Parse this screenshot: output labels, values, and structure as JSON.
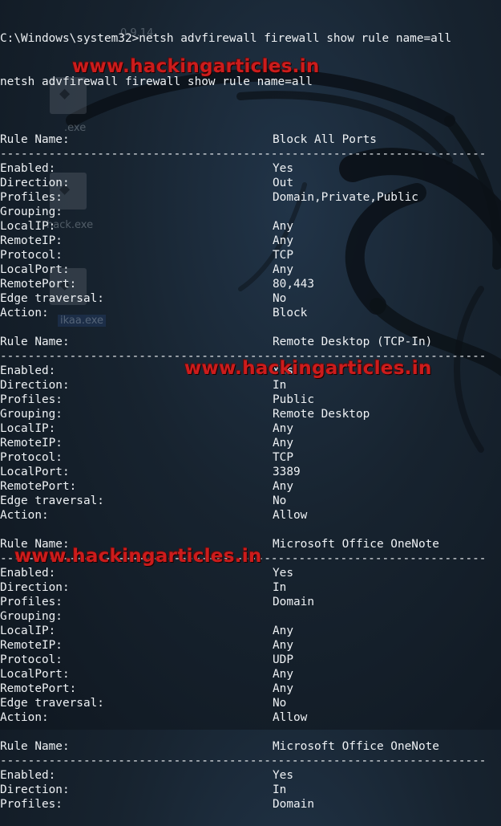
{
  "desktop": {
    "version_text": "0.9.14",
    "icons": [
      {
        "label": ".exe"
      },
      {
        "label": "hack.exe"
      },
      {
        "label": "ikaa.exe"
      }
    ]
  },
  "terminal": {
    "prompt_line": "C:\\Windows\\system32>netsh advfirewall firewall show rule name=all",
    "echo_line": "netsh advfirewall firewall show rule name=all",
    "separator": "----------------------------------------------------------------------",
    "rules": [
      {
        "rule_label": "Rule Name:",
        "rule_value": "Block All Ports",
        "fields": [
          {
            "key": "Enabled:",
            "value": "Yes"
          },
          {
            "key": "Direction:",
            "value": "Out"
          },
          {
            "key": "Profiles:",
            "value": "Domain,Private,Public"
          },
          {
            "key": "Grouping:",
            "value": ""
          },
          {
            "key": "LocalIP:",
            "value": "Any"
          },
          {
            "key": "RemoteIP:",
            "value": "Any"
          },
          {
            "key": "Protocol:",
            "value": "TCP"
          },
          {
            "key": "LocalPort:",
            "value": "Any"
          },
          {
            "key": "RemotePort:",
            "value": "80,443"
          },
          {
            "key": "Edge traversal:",
            "value": "No"
          },
          {
            "key": "Action:",
            "value": "Block"
          }
        ]
      },
      {
        "rule_label": "Rule Name:",
        "rule_value": "Remote Desktop (TCP-In)",
        "fields": [
          {
            "key": "Enabled:",
            "value": "Yes"
          },
          {
            "key": "Direction:",
            "value": "In"
          },
          {
            "key": "Profiles:",
            "value": "Public"
          },
          {
            "key": "Grouping:",
            "value": "Remote Desktop"
          },
          {
            "key": "LocalIP:",
            "value": "Any"
          },
          {
            "key": "RemoteIP:",
            "value": "Any"
          },
          {
            "key": "Protocol:",
            "value": "TCP"
          },
          {
            "key": "LocalPort:",
            "value": "3389"
          },
          {
            "key": "RemotePort:",
            "value": "Any"
          },
          {
            "key": "Edge traversal:",
            "value": "No"
          },
          {
            "key": "Action:",
            "value": "Allow"
          }
        ]
      },
      {
        "rule_label": "Rule Name:",
        "rule_value": "Microsoft Office OneNote",
        "fields": [
          {
            "key": "Enabled:",
            "value": "Yes"
          },
          {
            "key": "Direction:",
            "value": "In"
          },
          {
            "key": "Profiles:",
            "value": "Domain"
          },
          {
            "key": "Grouping:",
            "value": ""
          },
          {
            "key": "LocalIP:",
            "value": "Any"
          },
          {
            "key": "RemoteIP:",
            "value": "Any"
          },
          {
            "key": "Protocol:",
            "value": "UDP"
          },
          {
            "key": "LocalPort:",
            "value": "Any"
          },
          {
            "key": "RemotePort:",
            "value": "Any"
          },
          {
            "key": "Edge traversal:",
            "value": "No"
          },
          {
            "key": "Action:",
            "value": "Allow"
          }
        ]
      },
      {
        "rule_label": "Rule Name:",
        "rule_value": "Microsoft Office OneNote",
        "fields": [
          {
            "key": "Enabled:",
            "value": "Yes"
          },
          {
            "key": "Direction:",
            "value": "In"
          },
          {
            "key": "Profiles:",
            "value": "Domain"
          }
        ]
      }
    ]
  },
  "watermark": {
    "text": "www.hackingarticles.in",
    "color": "#cc1c1c"
  },
  "colors": {
    "terminal_text": "#eef1f4",
    "background": "#17232f"
  }
}
